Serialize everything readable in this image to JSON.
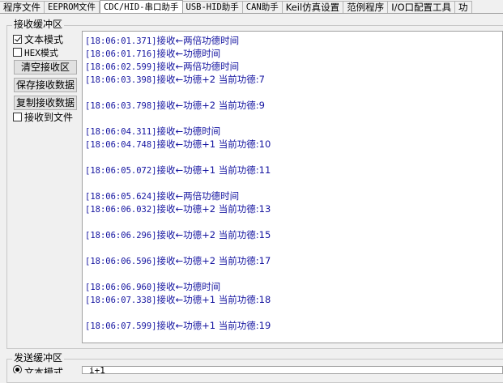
{
  "tabs": [
    {
      "label": "程序文件",
      "mono": false,
      "active": false
    },
    {
      "label": "EEPROM文件",
      "mono": true,
      "active": false
    },
    {
      "label": "CDC/HID-串口助手",
      "mono": true,
      "active": true
    },
    {
      "label": "USB-HID助手",
      "mono": true,
      "active": false
    },
    {
      "label": "CAN助手",
      "mono": true,
      "active": false
    },
    {
      "label": "Keil仿真设置",
      "mono": false,
      "active": false
    },
    {
      "label": "范例程序",
      "mono": false,
      "active": false
    },
    {
      "label": "I/O口配置工具",
      "mono": false,
      "active": false
    },
    {
      "label": "功",
      "mono": false,
      "active": false
    }
  ],
  "receive": {
    "group_title": "接收缓冲区",
    "text_mode_label": "文本模式",
    "text_mode_checked": true,
    "hex_mode_label": "HEX模式",
    "hex_mode_checked": false,
    "clear_button": "清空接收区",
    "save_button": "保存接收数据",
    "copy_button": "复制接收数据",
    "to_file_label": "接收到文件",
    "to_file_checked": false,
    "lines": [
      {
        "ts": "[18:06:01.371]",
        "msg": "接收←两倍功德时间"
      },
      {
        "ts": "[18:06:01.716]",
        "msg": "接收←功德时间"
      },
      {
        "ts": "[18:06:02.599]",
        "msg": "接收←两倍功德时间"
      },
      {
        "ts": "[18:06:03.398]",
        "msg": "接收←功德+2 当前功德:7"
      },
      {
        "ts": "",
        "msg": ""
      },
      {
        "ts": "[18:06:03.798]",
        "msg": "接收←功德+2 当前功德:9"
      },
      {
        "ts": "",
        "msg": ""
      },
      {
        "ts": "[18:06:04.311]",
        "msg": "接收←功德时间"
      },
      {
        "ts": "[18:06:04.748]",
        "msg": "接收←功德+1 当前功德:10"
      },
      {
        "ts": "",
        "msg": ""
      },
      {
        "ts": "[18:06:05.072]",
        "msg": "接收←功德+1 当前功德:11"
      },
      {
        "ts": "",
        "msg": ""
      },
      {
        "ts": "[18:06:05.624]",
        "msg": "接收←两倍功德时间"
      },
      {
        "ts": "[18:06:06.032]",
        "msg": "接收←功德+2 当前功德:13"
      },
      {
        "ts": "",
        "msg": ""
      },
      {
        "ts": "[18:06:06.296]",
        "msg": "接收←功德+2 当前功德:15"
      },
      {
        "ts": "",
        "msg": ""
      },
      {
        "ts": "[18:06:06.596]",
        "msg": "接收←功德+2 当前功德:17"
      },
      {
        "ts": "",
        "msg": ""
      },
      {
        "ts": "[18:06:06.960]",
        "msg": "接收←功德时间"
      },
      {
        "ts": "[18:06:07.338]",
        "msg": "接收←功德+1 当前功德:18"
      },
      {
        "ts": "",
        "msg": ""
      },
      {
        "ts": "[18:06:07.599]",
        "msg": "接收←功德+1 当前功德:19"
      }
    ]
  },
  "send": {
    "group_title": "发送缓冲区",
    "text_mode_label": "文本模式",
    "text_mode_checked": true,
    "input_value": "i+1"
  }
}
